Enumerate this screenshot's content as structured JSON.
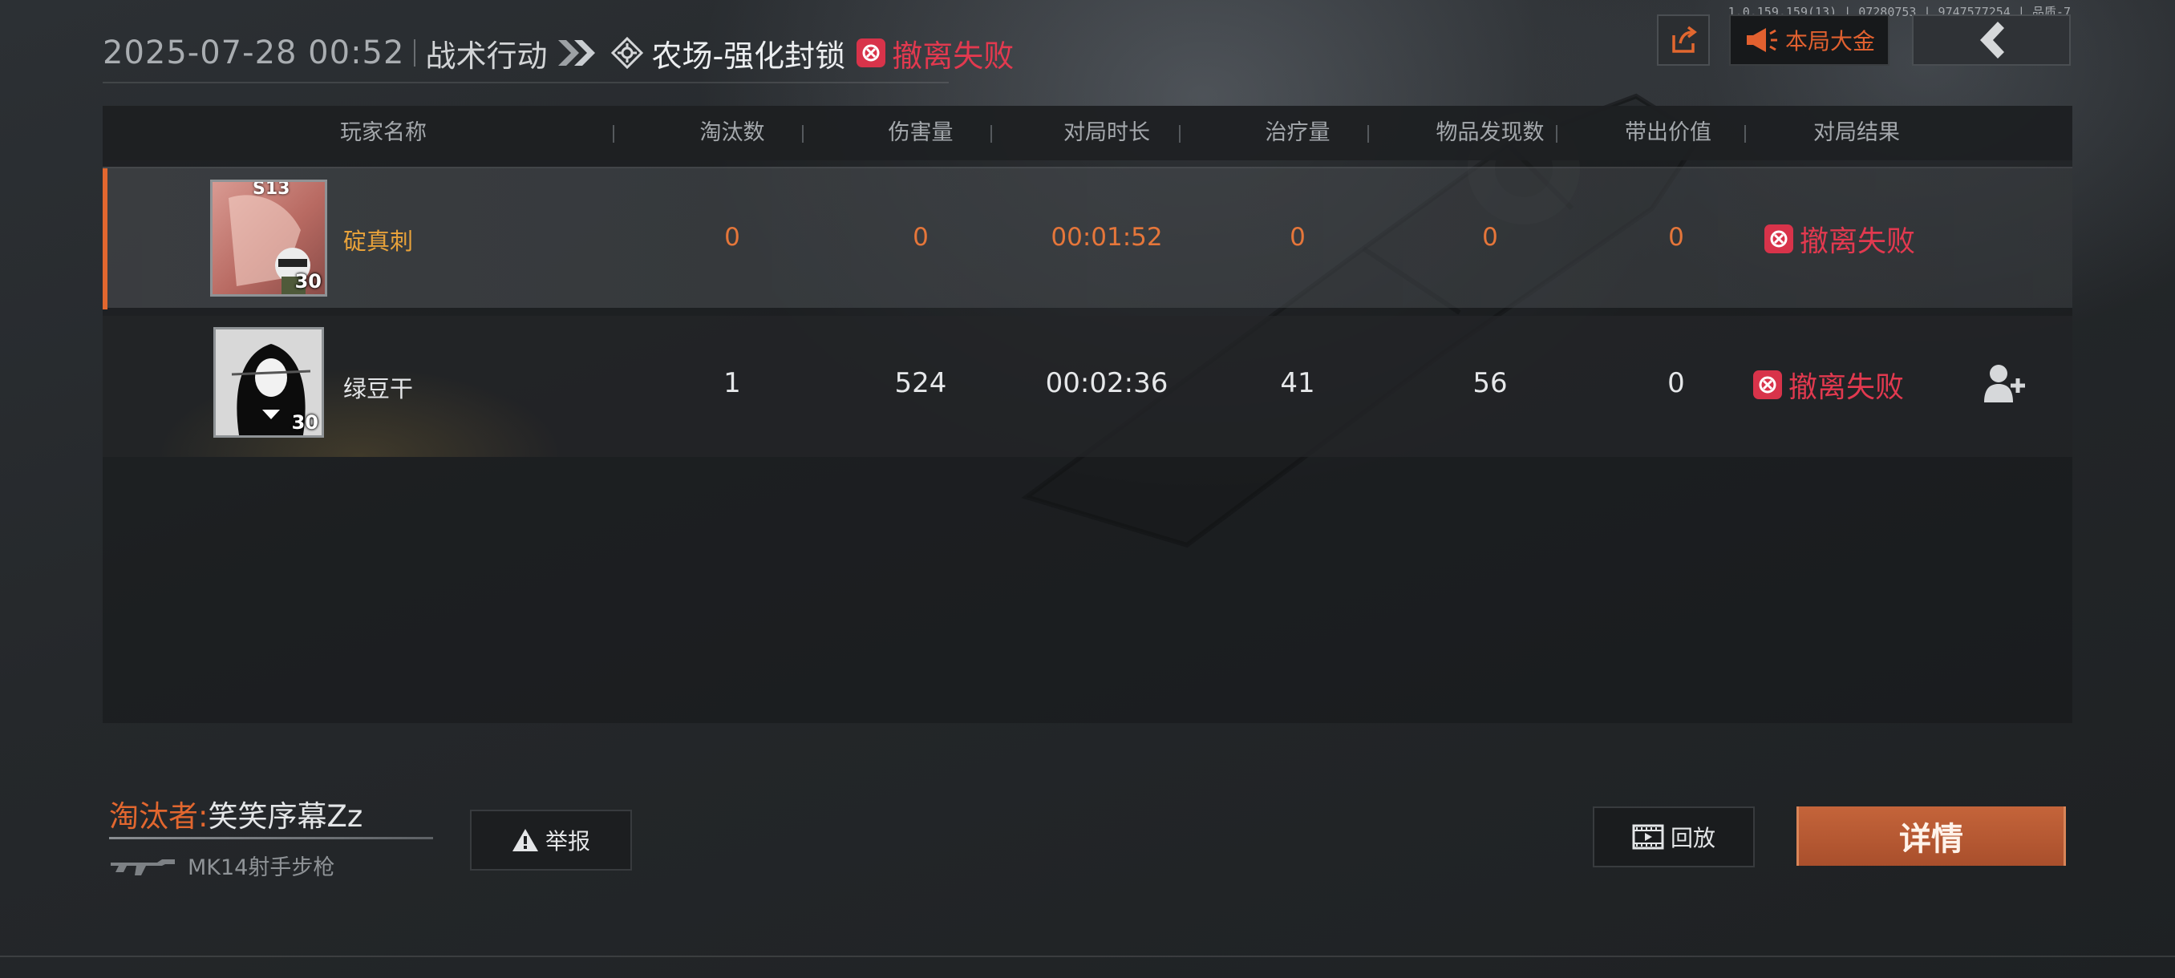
{
  "version_info": "1.0.159.159(13) | 07280753 | 9747577254 | 品质-7",
  "header": {
    "datetime": "2025-07-28 00:52",
    "mode": "战术行动",
    "map": "农场-强化封锁",
    "result": "撤离失败"
  },
  "top_buttons": {
    "share_icon": "share-icon",
    "jackpot_label": "本局大金",
    "back_icon": "chevron-left-icon"
  },
  "table": {
    "columns": [
      "玩家名称",
      "淘汰数",
      "伤害量",
      "对局时长",
      "治疗量",
      "物品发现数",
      "带出价值",
      "对局结果"
    ],
    "rows": [
      {
        "name": "碇真刺",
        "level": "30",
        "season": "S13",
        "kills": "0",
        "damage": "0",
        "duration": "00:01:52",
        "healing": "0",
        "items_found": "0",
        "extracted_value": "0",
        "result": "撤离失败",
        "highlight_color": "#e2672f"
      },
      {
        "name": "绿豆干",
        "level": "30",
        "kills": "1",
        "damage": "524",
        "duration": "00:02:36",
        "healing": "41",
        "items_found": "56",
        "extracted_value": "0",
        "result": "撤离失败"
      }
    ]
  },
  "killer": {
    "label": "淘汰者:",
    "name": "笑笑序幕Zz",
    "weapon": "MK14射手步枪"
  },
  "buttons": {
    "report": "举报",
    "replay": "回放",
    "details": "详情"
  },
  "colors": {
    "accent_orange": "#e2672f",
    "fail_red": "#e2394f"
  }
}
